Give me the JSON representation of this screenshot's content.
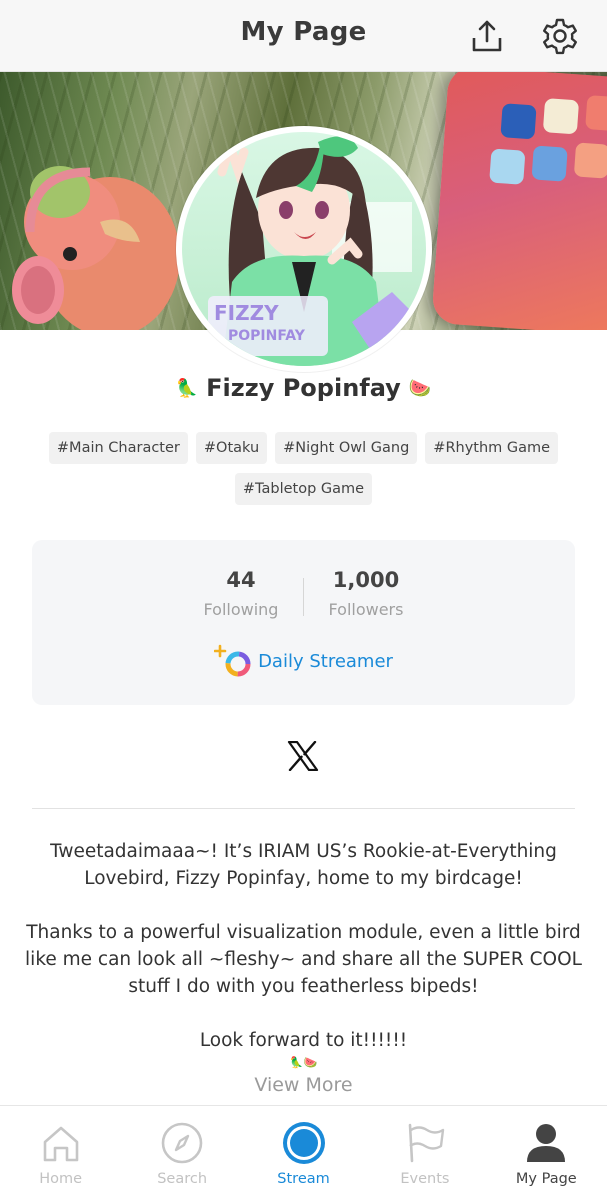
{
  "header": {
    "title": "My Page",
    "share_icon": "share-icon",
    "settings_icon": "gear-icon"
  },
  "profile": {
    "name": "Fizzy Popinfay",
    "name_prefix_emoji": "🦜",
    "name_suffix_emoji": "🍉",
    "avatar_text": [
      "FIZZY",
      "POPINFAY"
    ],
    "tags": [
      "#Main Character",
      "#Otaku",
      "#Night Owl Gang",
      "#Rhythm Game",
      "#Tabletop Game"
    ]
  },
  "stats": {
    "following_count": "44",
    "following_label": "Following",
    "followers_count": "1,000",
    "followers_label": "Followers",
    "daily_streamer_label": "Daily Streamer"
  },
  "social": {
    "x_icon": "x-logo-icon"
  },
  "bio": {
    "text": "Tweetadaimaaa~! It’s IRIAM US’s Rookie-at-Everything Lovebird, Fizzy Popinfay, home to my birdcage!\n\nThanks to a powerful visualization module, even a little bird like me can look all ~fleshy~ and share all the SUPER COOL stuff I do with you featherless bipeds!\n\nLook forward to it!!!!!!",
    "emoji_line": "🦜🍉",
    "view_more": "View More"
  },
  "nav": {
    "home": "Home",
    "search": "Search",
    "stream": "Stream",
    "events": "Events",
    "mypage": "My Page",
    "active": "My Page"
  },
  "colors": {
    "accent_blue": "#1a8ad8",
    "tag_bg": "#f1f1f1",
    "card_bg": "#f5f6f8",
    "inactive_gray": "#c2c2c2"
  }
}
